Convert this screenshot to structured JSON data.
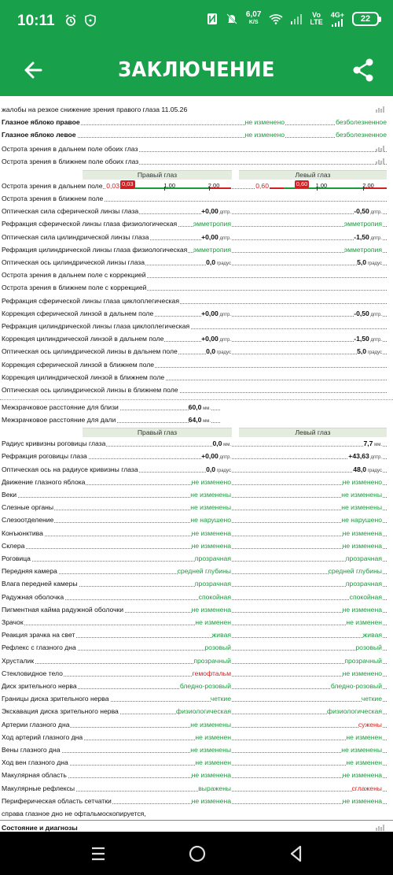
{
  "status_bar": {
    "time": "10:11",
    "speed_value": "6,07",
    "speed_unit": "K/S",
    "network_line1": "Vo",
    "network_line2": "LTE",
    "network_4g": "4G+",
    "battery": "22",
    "icons": [
      "alarm-icon",
      "shield-icon",
      "nfc-icon",
      "mute-bell-icon",
      "wifi-icon",
      "signal-icon"
    ]
  },
  "app_bar": {
    "title": "ЗАКЛЮЧЕНИЕ"
  },
  "complaint": "жалобы на резкое снижение зрения правого глаза  11.05.26",
  "eyeballs": [
    {
      "label": "Глазное яблоко правое",
      "v1": "не изменено",
      "v2": "безболезненное"
    },
    {
      "label": "Глазное яблоко левое",
      "v1": "не изменено",
      "v2": "безболезненное"
    }
  ],
  "both_eyes": [
    {
      "label": "Острота зрения в дальнем поле обоих глаз"
    },
    {
      "label": "Острота зрения в ближнем поле обоих глаз"
    }
  ],
  "section1": {
    "right_header": "Правый глаз",
    "left_header": "Левый глаз",
    "acuity_label": "Острота зрения в дальнем поле",
    "right_scale": {
      "value": "0,03",
      "marker": "0,03",
      "value_num": 0.03,
      "ticks": [
        "1,00",
        "2,00"
      ]
    },
    "left_scale": {
      "value": "0,60",
      "marker": "0,60",
      "value_num": 0.6,
      "ticks": [
        "1,00",
        "2,00"
      ]
    },
    "rows": [
      {
        "label": "Острота зрения в ближнем поле",
        "right": "",
        "right_unit": "",
        "left": "",
        "left_unit": "",
        "style": ""
      },
      {
        "label": "Оптическая сила сферической линзы глаза",
        "right": "+0,00",
        "right_unit": "дптр.",
        "left": "-0,50",
        "left_unit": "дптр.",
        "style": "dark"
      },
      {
        "label": "Рефракция сферической линзы глаза физиологическая",
        "right": "эмметропия",
        "right_unit": "",
        "left": "эмметропия",
        "left_unit": "",
        "style": "green"
      },
      {
        "label": "Оптическая сила цилиндрической линзы глаза",
        "right": "+0,00",
        "right_unit": "дптр.",
        "left": "-1,50",
        "left_unit": "дптр.",
        "style": "dark"
      },
      {
        "label": "Рефракция цилиндрической линзы глаза физиологическая",
        "right": "эмметропия",
        "right_unit": "",
        "left": "эмметропия",
        "left_unit": "",
        "style": "green"
      },
      {
        "label": "Оптическая ось цилиндрической линзы глаза",
        "right": "0,0",
        "right_unit": "градус",
        "left": "5,0",
        "left_unit": "градус",
        "style": "dark"
      },
      {
        "label": "Острота зрения в дальнем поле с коррекцией",
        "right": "",
        "right_unit": "",
        "left": "",
        "left_unit": "",
        "style": ""
      },
      {
        "label": "Острота зрения в ближнем поле с коррекцией",
        "right": "",
        "right_unit": "",
        "left": "",
        "left_unit": "",
        "style": ""
      },
      {
        "label": "Рефракция сферической линзы глаза циклоплегическая",
        "right": "",
        "right_unit": "",
        "left": "",
        "left_unit": "",
        "style": ""
      },
      {
        "label": "Коррекция сферической линзой в дальнем поле",
        "right": "+0,00",
        "right_unit": "дптр.",
        "left": "-0,50",
        "left_unit": "дптр.",
        "style": "dark"
      },
      {
        "label": "Рефракция цилиндрической линзы глаза циклоплегическая",
        "right": "",
        "right_unit": "",
        "left": "",
        "left_unit": "",
        "style": ""
      },
      {
        "label": "Коррекция цилиндрической линзой в дальнем поле",
        "right": "+0,00",
        "right_unit": "дптр.",
        "left": "-1,50",
        "left_unit": "дптр.",
        "style": "dark"
      },
      {
        "label": "Оптическая ось цилиндрической линзы в дальнем поле",
        "right": "0,0",
        "right_unit": "градус",
        "left": "5,0",
        "left_unit": "градус",
        "style": "dark"
      },
      {
        "label": "Коррекция сферической линзой в ближнем поле",
        "right": "",
        "right_unit": "",
        "left": "",
        "left_unit": "",
        "style": ""
      },
      {
        "label": "Коррекция цилиндрической линзой в ближнем поле",
        "right": "",
        "right_unit": "",
        "left": "",
        "left_unit": "",
        "style": ""
      },
      {
        "label": "Оптическая ось цилиндрической линзы в ближнем поле",
        "right": "",
        "right_unit": "",
        "left": "",
        "left_unit": "",
        "style": ""
      }
    ]
  },
  "pupillary": [
    {
      "label": "Межзрачковое расстояние для близи",
      "value": "60,0",
      "unit": "мм."
    },
    {
      "label": "Межзрачковое расстояние для дали",
      "value": "64,0",
      "unit": "мм."
    }
  ],
  "section2": {
    "right_header": "Правый глаз",
    "left_header": "Левый глаз",
    "rows": [
      {
        "label": "Радиус кривизны роговицы глаза",
        "right": "0,0",
        "right_unit": "мм.",
        "left": "7,7",
        "left_unit": "мм.",
        "rstyle": "dark",
        "lstyle": "dark"
      },
      {
        "label": "Рефракция роговицы глаза",
        "right": "+0,00",
        "right_unit": "дптр.",
        "left": "+43,63",
        "left_unit": "дптр.",
        "rstyle": "dark",
        "lstyle": "dark"
      },
      {
        "label": "Оптическая ось на радиусе кривизны глаза",
        "right": "0,0",
        "right_unit": "градус",
        "left": "48,0",
        "left_unit": "градус",
        "rstyle": "dark",
        "lstyle": "dark"
      },
      {
        "label": "Движение глазного яблока",
        "right": "не изменено",
        "right_unit": "",
        "left": "не изменено",
        "left_unit": "",
        "rstyle": "green",
        "lstyle": "green"
      },
      {
        "label": "Веки",
        "right": "не изменены",
        "right_unit": "",
        "left": "не изменены",
        "left_unit": "",
        "rstyle": "green",
        "lstyle": "green"
      },
      {
        "label": "Слезные органы",
        "right": "не изменены",
        "right_unit": "",
        "left": "не изменены",
        "left_unit": "",
        "rstyle": "green",
        "lstyle": "green"
      },
      {
        "label": "Слезоотделение",
        "right": "не нарушено",
        "right_unit": "",
        "left": "не нарушено",
        "left_unit": "",
        "rstyle": "green",
        "lstyle": "green"
      },
      {
        "label": "Конъюнктива",
        "right": "не изменена",
        "right_unit": "",
        "left": "не изменена",
        "left_unit": "",
        "rstyle": "green",
        "lstyle": "green"
      },
      {
        "label": "Склера",
        "right": "не изменена",
        "right_unit": "",
        "left": "не изменена",
        "left_unit": "",
        "rstyle": "green",
        "lstyle": "green"
      },
      {
        "label": "Роговица",
        "right": "прозрачная",
        "right_unit": "",
        "left": "прозрачная",
        "left_unit": "",
        "rstyle": "green",
        "lstyle": "green"
      },
      {
        "label": "Передняя камера",
        "right": "средней глубины",
        "right_unit": "",
        "left": "средней глубины",
        "left_unit": "",
        "rstyle": "green",
        "lstyle": "green"
      },
      {
        "label": "Влага передней камеры",
        "right": "прозрачная",
        "right_unit": "",
        "left": "прозрачная",
        "left_unit": "",
        "rstyle": "green",
        "lstyle": "green"
      },
      {
        "label": "Радужная оболочка",
        "right": "спокойная",
        "right_unit": "",
        "left": "спокойная",
        "left_unit": "",
        "rstyle": "green",
        "lstyle": "green"
      },
      {
        "label": "Пигментная кайма радужной оболочки",
        "right": "не изменена",
        "right_unit": "",
        "left": "не изменена",
        "left_unit": "",
        "rstyle": "green",
        "lstyle": "green"
      },
      {
        "label": "Зрачок",
        "right": "не изменен",
        "right_unit": "",
        "left": "не изменен",
        "left_unit": "",
        "rstyle": "green",
        "lstyle": "green"
      },
      {
        "label": "Реакция зрачка на свет",
        "right": "живая",
        "right_unit": "",
        "left": "живая",
        "left_unit": "",
        "rstyle": "green",
        "lstyle": "green"
      },
      {
        "label": "Рефлекс с глазного дна",
        "right": "розовый",
        "right_unit": "",
        "left": "розовый",
        "left_unit": "",
        "rstyle": "green",
        "lstyle": "green"
      },
      {
        "label": "Хрусталик",
        "right": "прозрачный",
        "right_unit": "",
        "left": "прозрачный",
        "left_unit": "",
        "rstyle": "green",
        "lstyle": "green"
      },
      {
        "label": "Стекловидное тело",
        "right": "гемофтальм",
        "right_unit": "",
        "left": "не изменено",
        "left_unit": "",
        "rstyle": "red",
        "lstyle": "green"
      },
      {
        "label": "Диск зрительного нерва",
        "right": "бледно-розовый",
        "right_unit": "",
        "left": "бледно-розовый",
        "left_unit": "",
        "rstyle": "green",
        "lstyle": "green"
      },
      {
        "label": "Границы диска зрительного нерва",
        "right": "четкие",
        "right_unit": "",
        "left": "четкие",
        "left_unit": "",
        "rstyle": "green",
        "lstyle": "green"
      },
      {
        "label": "Экскавация диска зрительного нерва",
        "right": "физиологическая",
        "right_unit": "",
        "left": "физиологическая",
        "left_unit": "",
        "rstyle": "green",
        "lstyle": "green"
      },
      {
        "label": "Артерии глазного дна",
        "right": "не изменены",
        "right_unit": "",
        "left": "сужены",
        "left_unit": "",
        "rstyle": "green",
        "lstyle": "red"
      },
      {
        "label": "Ход артерий глазного дна",
        "right": "не изменен",
        "right_unit": "",
        "left": "не изменен",
        "left_unit": "",
        "rstyle": "green",
        "lstyle": "green"
      },
      {
        "label": "Вены глазного дна",
        "right": "не изменены",
        "right_unit": "",
        "left": "не изменены",
        "left_unit": "",
        "rstyle": "green",
        "lstyle": "green"
      },
      {
        "label": "Ход вен глазного дна",
        "right": "не изменен",
        "right_unit": "",
        "left": "не изменен",
        "left_unit": "",
        "rstyle": "green",
        "lstyle": "green"
      },
      {
        "label": "Макулярная область",
        "right": "не изменена",
        "right_unit": "",
        "left": "не изменена",
        "left_unit": "",
        "rstyle": "green",
        "lstyle": "green"
      },
      {
        "label": "Макулярные рефлексы",
        "right": "выражены",
        "right_unit": "",
        "left": "сглажены",
        "left_unit": "",
        "rstyle": "green",
        "lstyle": "red"
      },
      {
        "label": "Периферическая область сетчатки",
        "right": "не изменена",
        "right_unit": "",
        "left": "не изменена",
        "left_unit": "",
        "rstyle": "green",
        "lstyle": "green"
      }
    ]
  },
  "note": "справа  глазное дно не офтальмоскопируется,",
  "footer_cut": "Состояние и диагнозы",
  "colors": {
    "brand": "#18a04a",
    "normal": "#1a9a3c",
    "abnormal": "#d21f1f"
  },
  "nav": [
    "recent-apps-icon",
    "home-icon",
    "back-triangle-icon"
  ]
}
